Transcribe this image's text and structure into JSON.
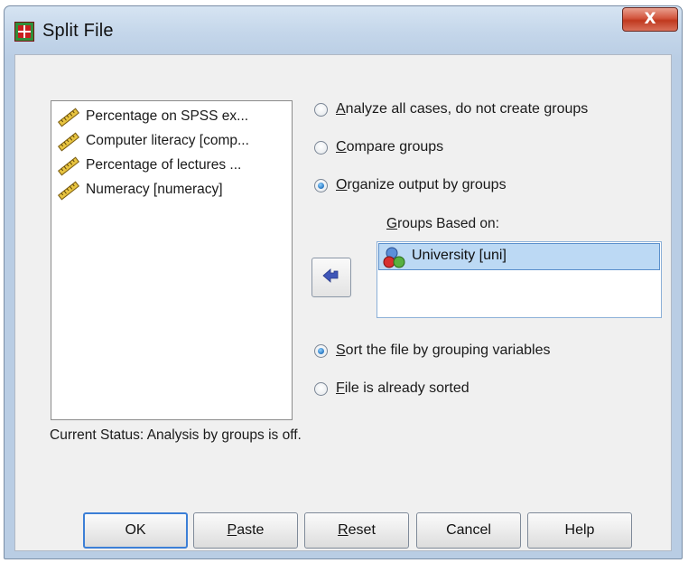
{
  "window": {
    "title": "Split File",
    "close_label": "X"
  },
  "variables": [
    "Percentage on SPSS ex...",
    "Computer literacy [comp...",
    "Percentage of lectures ...",
    "Numeracy [numeracy]"
  ],
  "options": {
    "analyze_all": {
      "mnemonic": "A",
      "rest": "nalyze all cases, do not create groups",
      "selected": false
    },
    "compare": {
      "mnemonic": "C",
      "rest": "ompare groups",
      "selected": false
    },
    "organize": {
      "mnemonic": "O",
      "rest": "rganize output by groups",
      "selected": true
    }
  },
  "groups": {
    "label_mnemonic": "G",
    "label_rest": "roups Based on:",
    "items": [
      "University [uni]"
    ]
  },
  "sort_options": {
    "sort": {
      "mnemonic": "S",
      "rest": "ort the file by grouping variables",
      "selected": true
    },
    "already": {
      "mnemonic": "F",
      "rest": "ile is already sorted",
      "selected": false
    }
  },
  "status": "Current Status: Analysis by groups is off.",
  "buttons": {
    "ok": "OK",
    "paste_mnemonic": "P",
    "paste_rest": "aste",
    "reset_mnemonic": "R",
    "reset_rest": "eset",
    "cancel": "Cancel",
    "help": "Help"
  },
  "colors": {
    "selection": "#bcd9f4",
    "accent": "#3c7fd6",
    "close": "#c0391f"
  }
}
